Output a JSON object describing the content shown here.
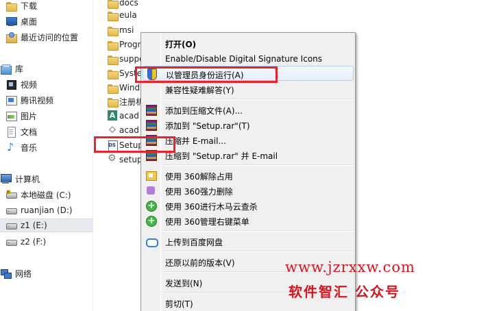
{
  "nav": {
    "downloads": "下载",
    "desktop": "桌面",
    "recent": "最近访问的位置",
    "libraries": "库",
    "videos": "视频",
    "tencent_video": "腾讯视频",
    "pictures": "图片",
    "documents": "文档",
    "music": "音乐",
    "computer": "计算机",
    "drive_c": "本地磁盘 (C:)",
    "drive_d": "ruanjian (D:)",
    "drive_e": "z1 (E:)",
    "drive_f": "z2 (F:)",
    "network": "网络"
  },
  "files": [
    {
      "name": "docs",
      "icon": "folder-icon"
    },
    {
      "name": "eula",
      "icon": "folder-icon"
    },
    {
      "name": "msi",
      "icon": "folder-icon"
    },
    {
      "name": "Progr",
      "icon": "folder-icon"
    },
    {
      "name": "suppo",
      "icon": "folder-icon"
    },
    {
      "name": "Syste",
      "icon": "folder-icon"
    },
    {
      "name": "Wind",
      "icon": "folder-icon"
    },
    {
      "name": "注册机",
      "icon": "folder-icon"
    },
    {
      "name": "acad",
      "icon": "app-icon"
    },
    {
      "name": "acad",
      "icon": "lsp-file-icon"
    },
    {
      "name": "Setup",
      "icon": "setup-exe-icon"
    },
    {
      "name": "setup",
      "icon": "ini-file-icon"
    }
  ],
  "context_menu": {
    "open": "打开(O)",
    "signature": "Enable/Disable Digital Signature Icons",
    "run_as_admin": "以管理员身份运行(A)",
    "compat": "兼容性疑难解答(Y)",
    "add_archive": "添加到压缩文件(A)...",
    "add_setup_rar": "添加到 \"Setup.rar\"(T)",
    "compress_email": "压缩并 E-mail...",
    "compress_setup_email": "压缩到 \"Setup.rar\" 并 E-mail",
    "s360_unlock": "使用 360解除占用",
    "s360_delete": "使用 360强力删除",
    "s360_trojan": "使用 360进行木马云查杀",
    "s360_menu": "使用 360管理右键菜单",
    "baidu_upload": "上传到百度网盘",
    "restore": "还原以前的版本(V)",
    "send_to": "发送到(N)",
    "cut": "剪切(T)"
  },
  "watermark": {
    "url": "www.jzrxxw.com",
    "text": "软件智汇 公众号"
  },
  "colors": {
    "highlight": "#e8232c",
    "watermark": "#d8141c"
  }
}
